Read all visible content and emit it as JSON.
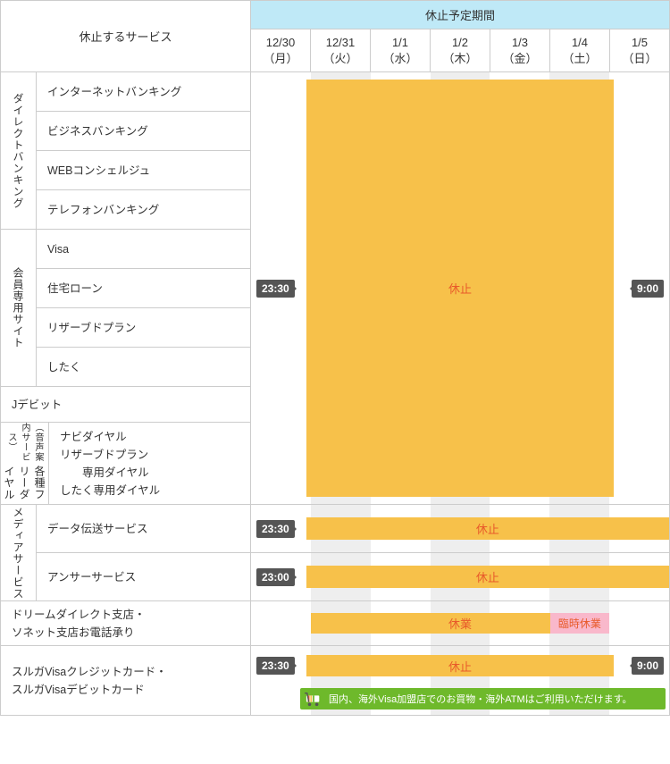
{
  "header": {
    "services_label": "休止するサービス",
    "period_label": "休止予定期間",
    "dates": [
      {
        "md": "12/30",
        "dow": "（月）"
      },
      {
        "md": "12/31",
        "dow": "（火）"
      },
      {
        "md": "1/1",
        "dow": "（水）"
      },
      {
        "md": "1/2",
        "dow": "（木）"
      },
      {
        "md": "1/3",
        "dow": "（金）"
      },
      {
        "md": "1/4",
        "dow": "（土）"
      },
      {
        "md": "1/5",
        "dow": "（日）"
      }
    ]
  },
  "groups": {
    "direct": {
      "label": "ダイレクトバンキング",
      "items": [
        "インターネットバンキング",
        "ビジネスバンキング",
        "WEBコンシェルジュ",
        "テレフォンバンキング"
      ]
    },
    "member": {
      "label": "会員専用サイト",
      "items": [
        "Visa",
        "住宅ローン",
        "リザーブドプラン",
        "したく"
      ]
    },
    "jdebit": {
      "label": "Jデビット"
    },
    "freedial": {
      "label_main": "各種フリーダイヤル",
      "label_sub": "（音声案内サービス）",
      "lines": [
        "ナビダイヤル",
        "リザーブドプラン",
        "　　専用ダイヤル",
        "したく専用ダイヤル"
      ]
    },
    "media": {
      "label": "メディアサービス",
      "items": [
        "データ伝送サービス",
        "アンサーサービス"
      ]
    },
    "dream": {
      "line1": "ドリームダイレクト支店・",
      "line2": "ソネット支店お電話承り"
    },
    "visa": {
      "line1": "スルガVisaクレジットカード・",
      "line2": "スルガVisaデビットカード"
    }
  },
  "labels": {
    "suspend": "休止",
    "closed": "休業",
    "temp_closed": "臨時休業"
  },
  "times": {
    "t2330": "23:30",
    "t2300": "23:00",
    "t0900": "9:00"
  },
  "note": "国内、海外Visa加盟店でのお買物・海外ATMはご利用いただけます。"
}
